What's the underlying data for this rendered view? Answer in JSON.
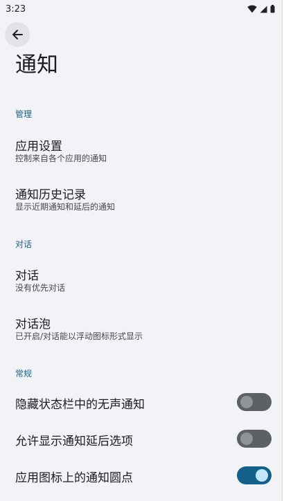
{
  "status_bar": {
    "time": "3:23"
  },
  "header": {
    "title": "通知"
  },
  "sections": [
    {
      "header": "管理",
      "items": [
        {
          "title": "应用设置",
          "summary": "控制来自各个应用的通知"
        },
        {
          "title": "通知历史记录",
          "summary": "显示近期通知和延后的通知"
        }
      ]
    },
    {
      "header": "对话",
      "items": [
        {
          "title": "对话",
          "summary": "没有优先对话"
        },
        {
          "title": "对话泡",
          "summary": "已开启/对话能以浮动图标形式显示"
        }
      ]
    },
    {
      "header": "常规",
      "items": [
        {
          "title": "隐藏状态栏中的无声通知",
          "state": "off"
        },
        {
          "title": "允许显示通知延后选项",
          "state": "off"
        },
        {
          "title": "应用图标上的通知圆点",
          "state": "on"
        }
      ]
    }
  ],
  "colors": {
    "accent": "#13608a",
    "section_header": "#1f6486",
    "switch_off": "#5d6166"
  }
}
